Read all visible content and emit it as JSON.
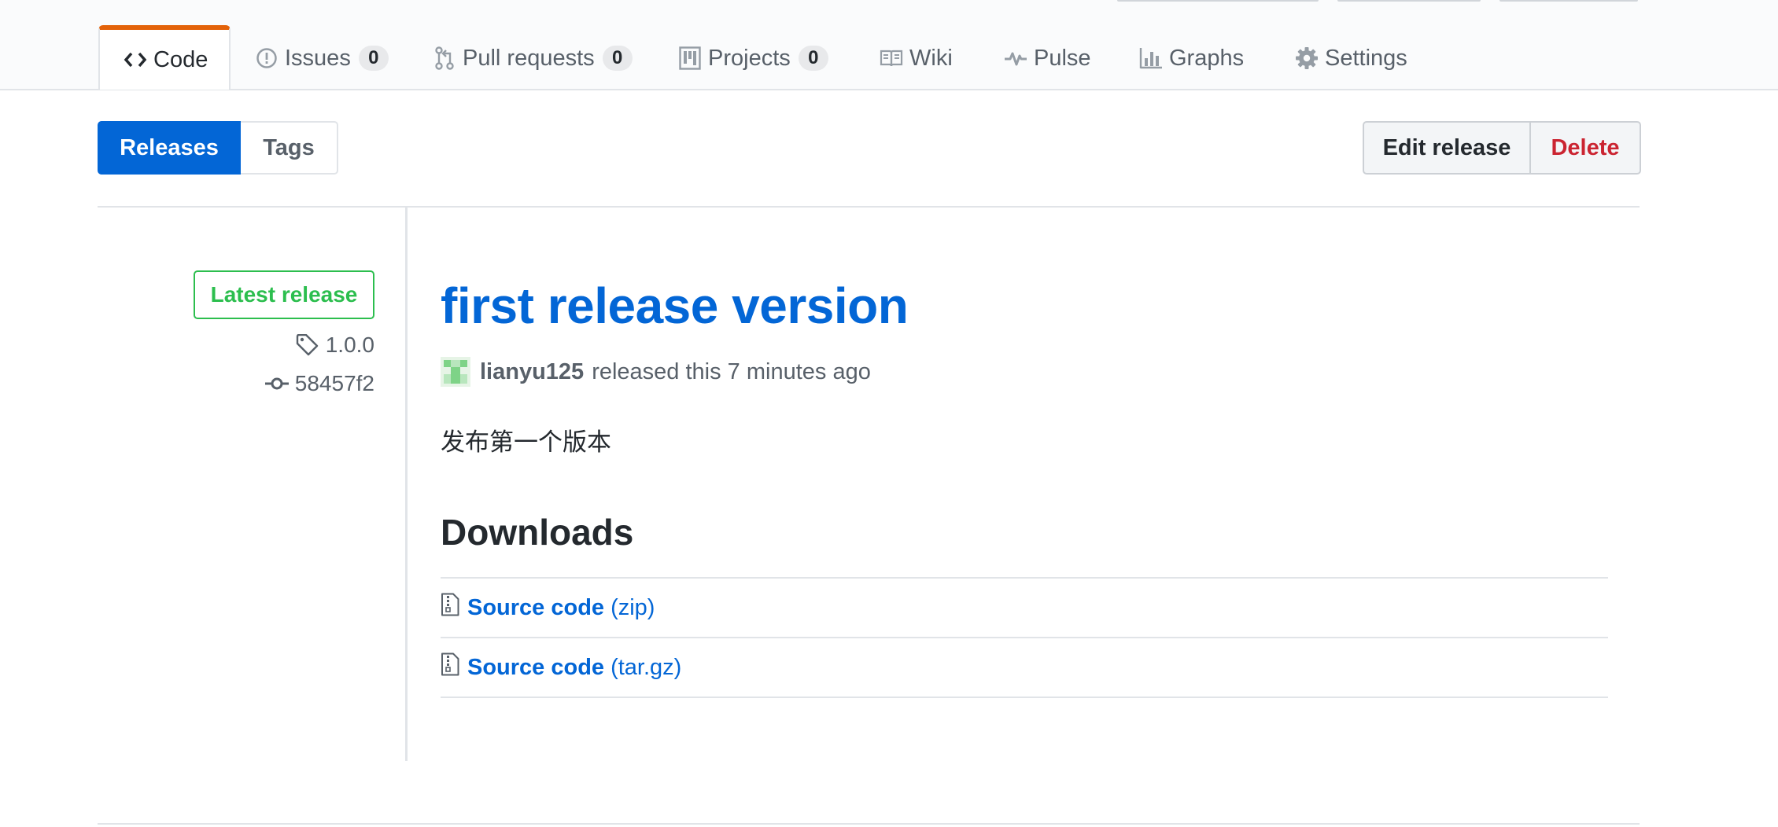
{
  "nav": {
    "tabs": [
      {
        "label": "Code",
        "icon": "code-icon",
        "selected": true
      },
      {
        "label": "Issues",
        "icon": "issue-opened-icon",
        "count": "0"
      },
      {
        "label": "Pull requests",
        "icon": "git-pull-request-icon",
        "count": "0"
      },
      {
        "label": "Projects",
        "icon": "project-icon",
        "count": "0"
      },
      {
        "label": "Wiki",
        "icon": "book-icon"
      },
      {
        "label": "Pulse",
        "icon": "pulse-icon"
      },
      {
        "label": "Graphs",
        "icon": "graph-icon"
      },
      {
        "label": "Settings",
        "icon": "gear-icon"
      }
    ]
  },
  "subnav": {
    "releases_label": "Releases",
    "tags_label": "Tags",
    "edit_label": "Edit release",
    "delete_label": "Delete"
  },
  "release": {
    "badge": "Latest release",
    "tag": "1.0.0",
    "commit": "58457f2",
    "title": "first release version",
    "author": "lianyu125",
    "released_text": "released this 7 minutes ago",
    "description": "发布第一个版本",
    "downloads_heading": "Downloads",
    "downloads": [
      {
        "name": "Source code",
        "ext": "(zip)",
        "icon": "file-zip-icon"
      },
      {
        "name": "Source code",
        "ext": "(tar.gz)",
        "icon": "file-zip-icon"
      }
    ]
  },
  "colors": {
    "accent": "#0366d6",
    "selected_tab_border": "#e36209",
    "latest_green": "#2cbe4e",
    "danger": "#cb2431",
    "muted_text": "#586069"
  }
}
